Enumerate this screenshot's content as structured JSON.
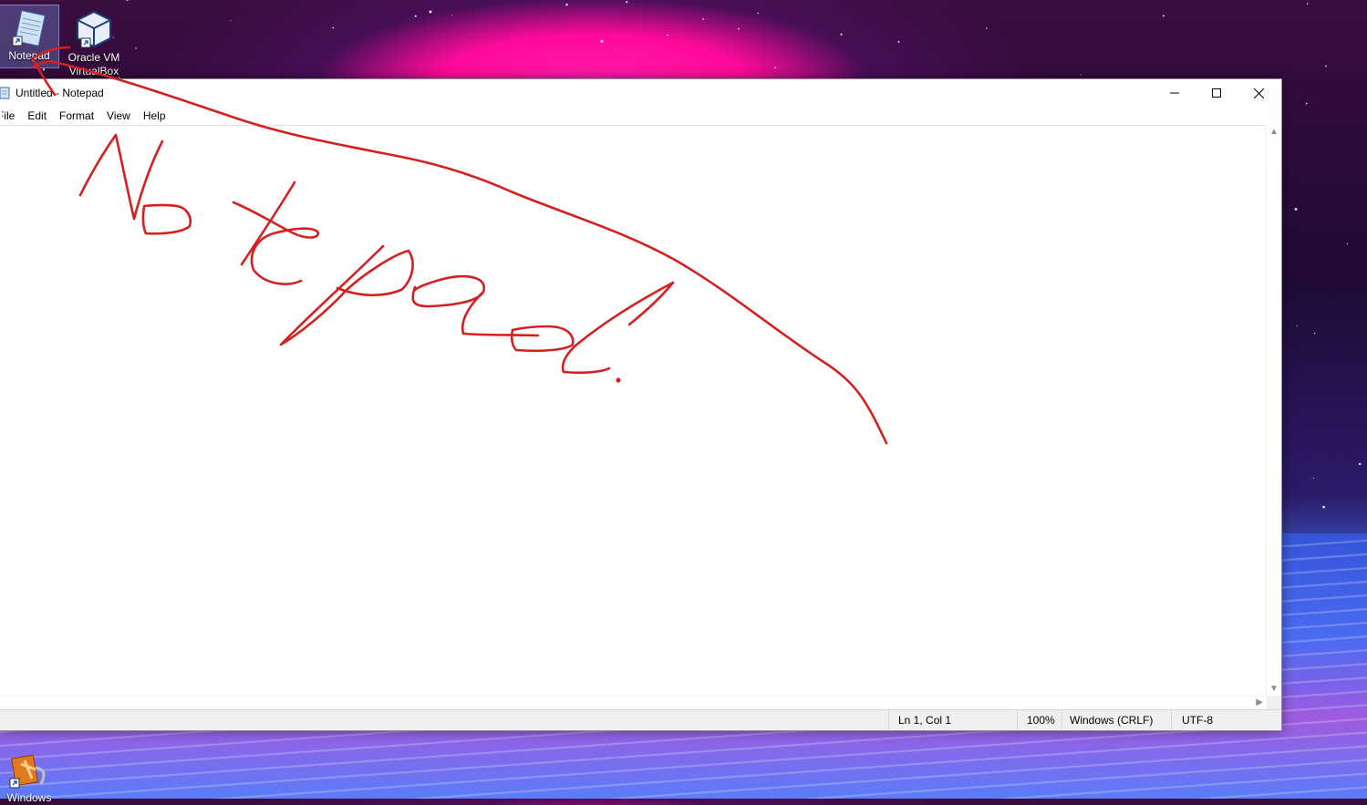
{
  "desktop": {
    "icons": [
      {
        "label": "Notepad",
        "icon": "notepad-icon"
      },
      {
        "label": "Oracle VM VirtualBox",
        "icon": "virtualbox-icon"
      },
      {
        "label": "Windows",
        "icon": "windows-media-icon"
      }
    ]
  },
  "window": {
    "title": "Untitled - Notepad",
    "controls": {
      "minimize": "minimize-icon",
      "maximize": "maximize-icon",
      "close": "close-icon"
    }
  },
  "menu": [
    "File",
    "Edit",
    "Format",
    "View",
    "Help"
  ],
  "editor": {
    "content": ""
  },
  "status": {
    "position": "Ln 1, Col 1",
    "zoom": "100%",
    "line_ending": "Windows (CRLF)",
    "encoding": "UTF-8"
  },
  "annotation": {
    "ink_color": "#d42020"
  }
}
